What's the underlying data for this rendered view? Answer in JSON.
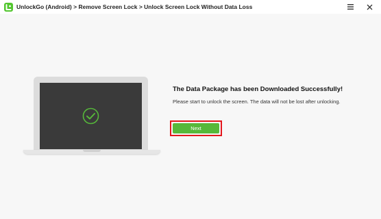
{
  "window": {
    "breadcrumb": [
      "UnlockGo (Android)",
      "Remove Screen Lock",
      "Unlock Screen Lock Without Data Loss"
    ],
    "separator": ">",
    "menu_icon": "hamburger-menu-icon",
    "close_icon": "close-icon"
  },
  "main": {
    "title": "The Data Package has been Downloaded Successfully!",
    "description": "Please start to unlock the screen. The data will not be lost after unlocking.",
    "next_button": "Next"
  },
  "colors": {
    "accent": "#56b83a",
    "highlight": "#e3161c",
    "screen": "#3a3a3a"
  }
}
